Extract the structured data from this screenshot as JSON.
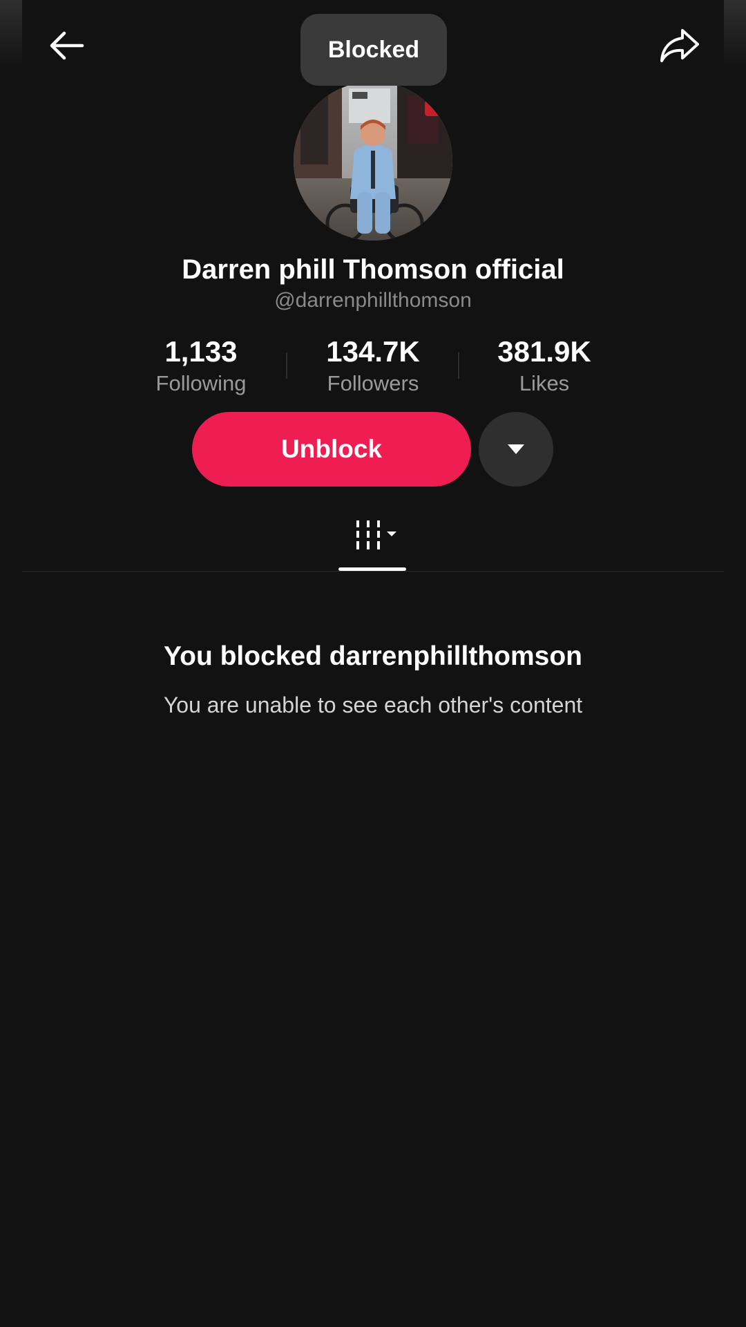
{
  "header": {
    "back_icon": "arrow-left-icon",
    "share_icon": "share-arrow-icon",
    "toast_text": "Blocked"
  },
  "profile": {
    "display_name": "Darren phill Thomson official",
    "username": "@darrenphillthomson",
    "avatar_description_icon": "avatar-photo"
  },
  "stats": [
    {
      "value": "1,133",
      "label": "Following"
    },
    {
      "value": "134.7K",
      "label": "Followers"
    },
    {
      "value": "381.9K",
      "label": "Likes"
    }
  ],
  "actions": {
    "unblock_label": "Unblock",
    "more_icon": "caret-down-icon"
  },
  "tabs": {
    "active_icon": "grid-videos-icon"
  },
  "empty_state": {
    "title": "You blocked darrenphillthomson",
    "subtitle": "You are unable to see each other's content"
  },
  "colors": {
    "background": "#121212",
    "accent": "#ee1d52",
    "toast_bg": "#3a3a3a",
    "secondary_btn": "#2f2f2f"
  }
}
